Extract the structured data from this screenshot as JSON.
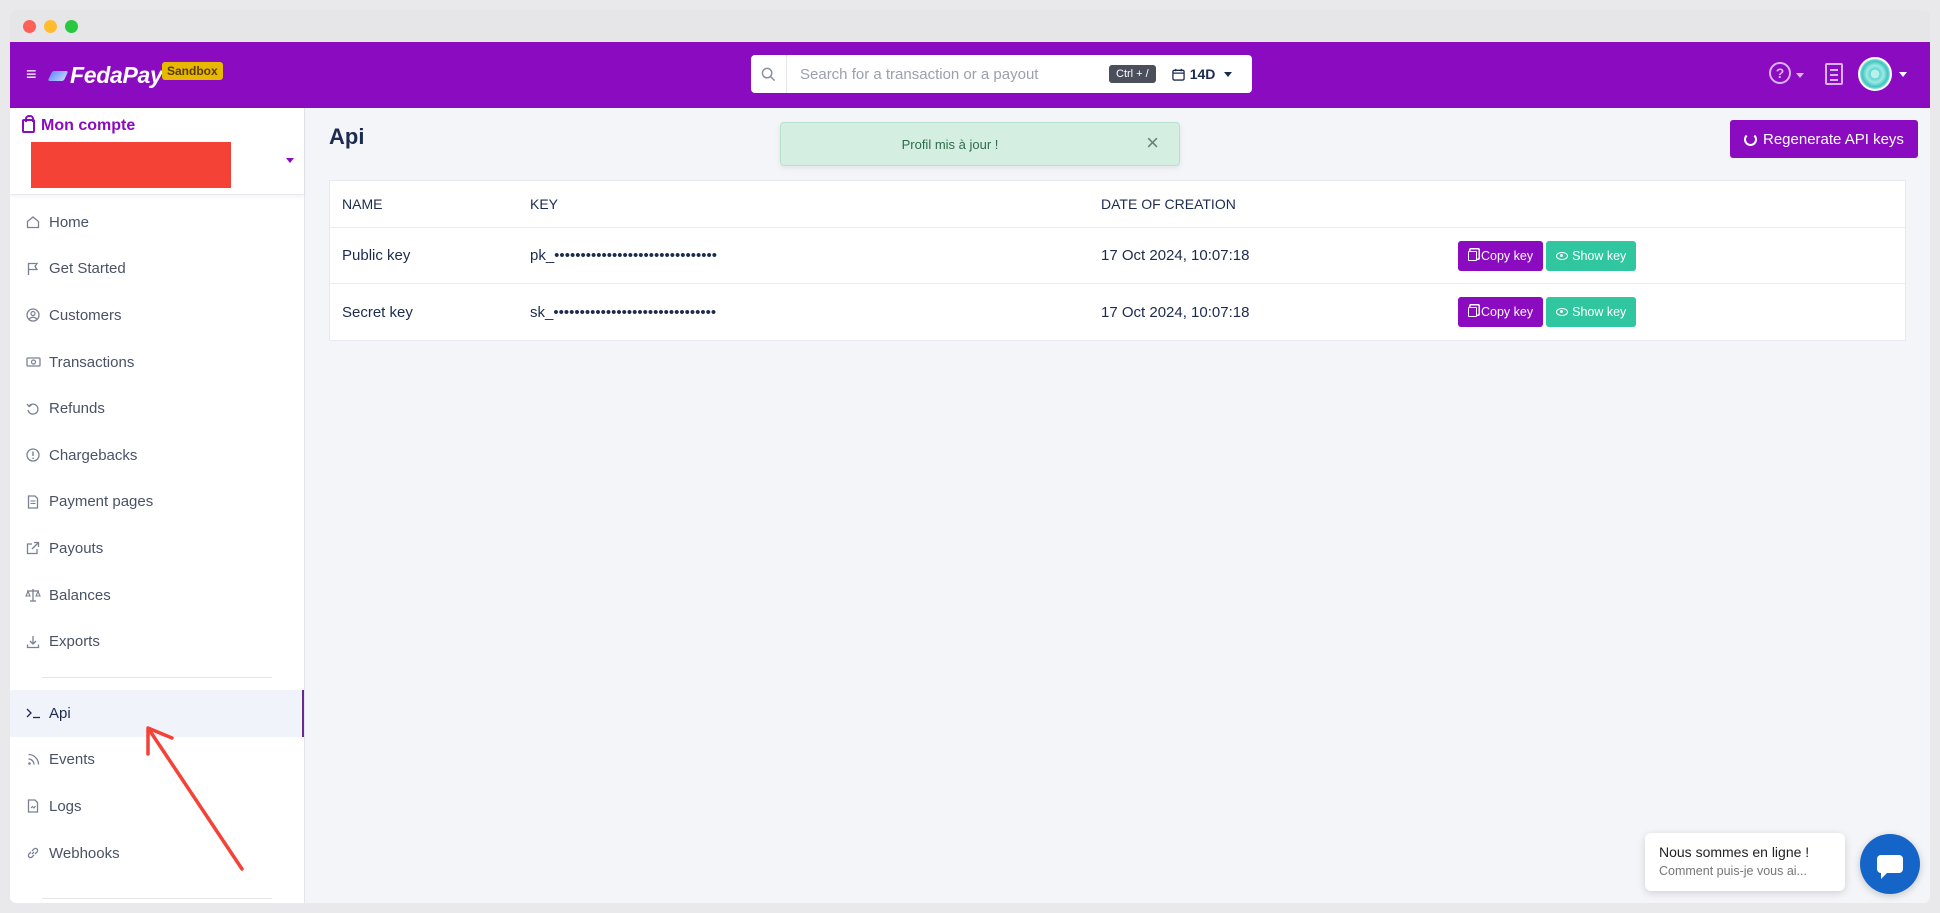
{
  "app": {
    "brand": "FedaPay",
    "env_badge": "Sandbox"
  },
  "topbar": {
    "search_placeholder": "Search for a transaction or a payout",
    "shortcut": "Ctrl + /",
    "period": "14D"
  },
  "sidebar": {
    "account_title": "Mon compte",
    "items": [
      {
        "label": "Home",
        "icon": "home-icon"
      },
      {
        "label": "Get Started",
        "icon": "flag-icon"
      },
      {
        "label": "Customers",
        "icon": "user-circle-icon"
      },
      {
        "label": "Transactions",
        "icon": "money-icon"
      },
      {
        "label": "Refunds",
        "icon": "refund-icon"
      },
      {
        "label": "Chargebacks",
        "icon": "alert-icon"
      },
      {
        "label": "Payment pages",
        "icon": "page-icon"
      },
      {
        "label": "Payouts",
        "icon": "external-icon"
      },
      {
        "label": "Balances",
        "icon": "scale-icon"
      },
      {
        "label": "Exports",
        "icon": "download-icon"
      }
    ],
    "dev_items": [
      {
        "label": "Api",
        "icon": "terminal-icon"
      },
      {
        "label": "Events",
        "icon": "rss-icon"
      },
      {
        "label": "Logs",
        "icon": "file-icon"
      },
      {
        "label": "Webhooks",
        "icon": "link-icon"
      }
    ]
  },
  "main": {
    "title": "Api",
    "regenerate_label": "Regenerate API keys",
    "toast": "Profil mis à jour !",
    "columns": [
      "NAME",
      "KEY",
      "DATE OF CREATION"
    ],
    "rows": [
      {
        "name": "Public key",
        "key": "pk_•••••••••••••••••••••••••••••••",
        "date": "17 Oct 2024, 10:07:18"
      },
      {
        "name": "Secret key",
        "key": "sk_•••••••••••••••••••••••••••••••",
        "date": "17 Oct 2024, 10:07:18"
      }
    ],
    "copy_label": "Copy key",
    "show_label": "Show key"
  },
  "chat": {
    "title": "Nous sommes en ligne !",
    "subtitle": "Comment puis-je vous ai..."
  },
  "colors": {
    "brand": "#8a0bc0",
    "accent_green": "#2fc6a0",
    "chat_blue": "#1565c9",
    "annotation_red": "#f44336"
  }
}
